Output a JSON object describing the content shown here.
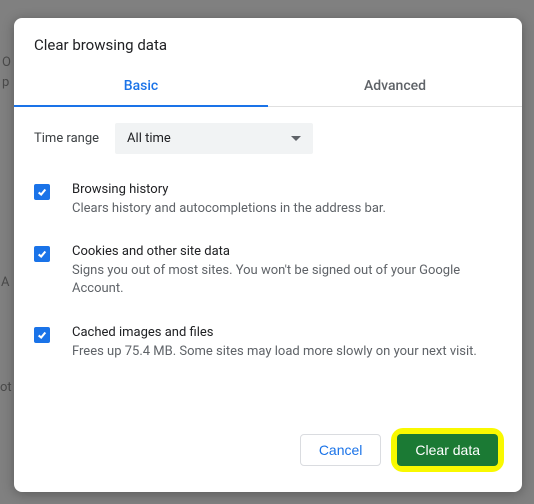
{
  "title": "Clear browsing data",
  "tabs": {
    "basic": "Basic",
    "advanced": "Advanced"
  },
  "time": {
    "label": "Time range",
    "value": "All time"
  },
  "options": [
    {
      "title": "Browsing history",
      "desc": "Clears history and autocompletions in the address bar."
    },
    {
      "title": "Cookies and other site data",
      "desc": "Signs you out of most sites. You won't be signed out of your Google Account."
    },
    {
      "title": "Cached images and files",
      "desc": "Frees up 75.4 MB. Some sites may load more slowly on your next visit."
    }
  ],
  "buttons": {
    "cancel": "Cancel",
    "clear": "Clear data"
  }
}
